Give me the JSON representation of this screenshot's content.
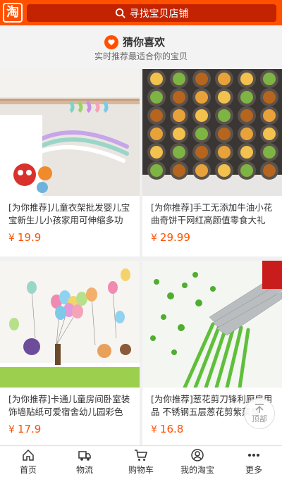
{
  "header": {
    "logo_text": "淘",
    "search_placeholder": "寻找宝贝店铺"
  },
  "guess": {
    "title": "猜你喜欢",
    "subtitle": "实时推荐最适合你的宝贝"
  },
  "products": [
    {
      "title": "[为你推荐]儿童衣架批发婴儿宝宝新生儿小孩家用可伸缩多功能",
      "currency": "¥",
      "price": "19.9"
    },
    {
      "title": "[为你推荐]手工无添加牛油小花曲奇饼干网红高颜值零食大礼包",
      "currency": "¥",
      "price": "29.99"
    },
    {
      "title": "[为你推荐]卡通儿童房间卧室装饰墙贴纸可爱宿舍幼儿园彩色气球",
      "currency": "¥",
      "price": "17.9"
    },
    {
      "title": "[为你推荐]葱花剪刀锋利厨房用品 不锈钢五层葱花剪紫菜剪",
      "currency": "¥",
      "price": "16.8"
    }
  ],
  "back_to_top": "顶部",
  "tabbar": [
    {
      "label": "首页",
      "icon": "home-icon"
    },
    {
      "label": "物流",
      "icon": "truck-icon"
    },
    {
      "label": "购物车",
      "icon": "cart-icon"
    },
    {
      "label": "我的淘宝",
      "icon": "user-icon"
    },
    {
      "label": "更多",
      "icon": "more-icon"
    }
  ],
  "colors": {
    "brand": "#ff5000",
    "search_bg": "#c32300",
    "price": "#ff5000"
  }
}
